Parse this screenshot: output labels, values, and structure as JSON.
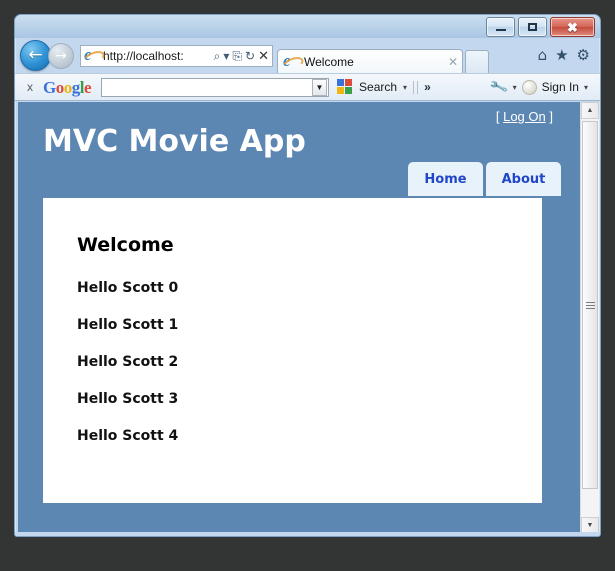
{
  "window": {
    "buttons": {
      "minimize": "Minimize",
      "maximize": "Maximize",
      "close": "✖"
    }
  },
  "browser": {
    "back_glyph": "←",
    "forward_glyph": "→",
    "address": {
      "url": "http://localhost:",
      "search_icon": "⌕",
      "dropdown_caret": "▾",
      "compat_icon": "⎘",
      "refresh_icon": "↻",
      "stop_icon": "✕"
    },
    "tab": {
      "title": "Welcome",
      "close_glyph": "✕"
    },
    "command_icons": {
      "home": "⌂",
      "favorites": "★",
      "tools": "⚙"
    }
  },
  "google_toolbar": {
    "close_label": "x",
    "logo": {
      "g1": "G",
      "o1": "o",
      "o2": "o",
      "g2": "g",
      "l": "l",
      "e": "e"
    },
    "search_value": "",
    "combo_caret": "▼",
    "search_label": "Search",
    "search_caret": "▾",
    "more_chevrons": "»",
    "wrench_caret": "▾",
    "signin_label": "Sign In",
    "signin_caret": "▾"
  },
  "page": {
    "logon_prefix": "[",
    "logon_link": "Log On",
    "logon_suffix": "]",
    "site_title": "MVC Movie App",
    "nav": [
      {
        "label": "Home"
      },
      {
        "label": "About"
      }
    ],
    "heading": "Welcome",
    "lines": [
      "Hello Scott 0",
      "Hello Scott 1",
      "Hello Scott 2",
      "Hello Scott 3",
      "Hello Scott 4"
    ]
  },
  "scrollbar": {
    "up_glyph": "▲",
    "down_glyph": "▼"
  },
  "colors": {
    "page_blue": "#5c87b2",
    "nav_tab_bg": "#e8f2fb",
    "nav_tab_text": "#2147c8",
    "content_bg": "#ffffff",
    "desktop": "#333434"
  }
}
